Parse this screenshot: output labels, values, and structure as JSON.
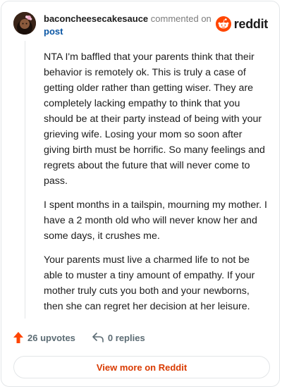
{
  "comment": {
    "username": "baconcheesecakesauce",
    "action_text": "commented on",
    "target_link": "post",
    "paragraphs": [
      "NTA I'm baffled that your parents think that their behavior is remotely ok. This is truly a case of getting older rather than getting wiser. They are completely lacking empathy to think that you should be at their party instead of being with your grieving wife. Losing your mom so soon after giving birth must be horrific. So many feelings and regrets about the future that will never come to pass.",
      "I spent months in a tailspin, mourning my mother. I have a 2 month old who will never know her and some days, it crushes me.",
      "Your parents must live a charmed life to not be able to muster a tiny amount of empathy. If your mother truly cuts you both and your newborns, then she can regret her decision at her leisure."
    ]
  },
  "brand": {
    "logo_text": "reddit",
    "logo_icon": "reddit-snoo-icon",
    "accent_color": "#ff4500"
  },
  "footer": {
    "upvotes_label": "26 upvotes",
    "upvote_icon": "upvote-arrow-icon",
    "replies_label": "0 replies",
    "reply_icon": "reply-arrow-icon",
    "view_more_label": "View more on Reddit",
    "view_more_color": "#d93a00"
  }
}
